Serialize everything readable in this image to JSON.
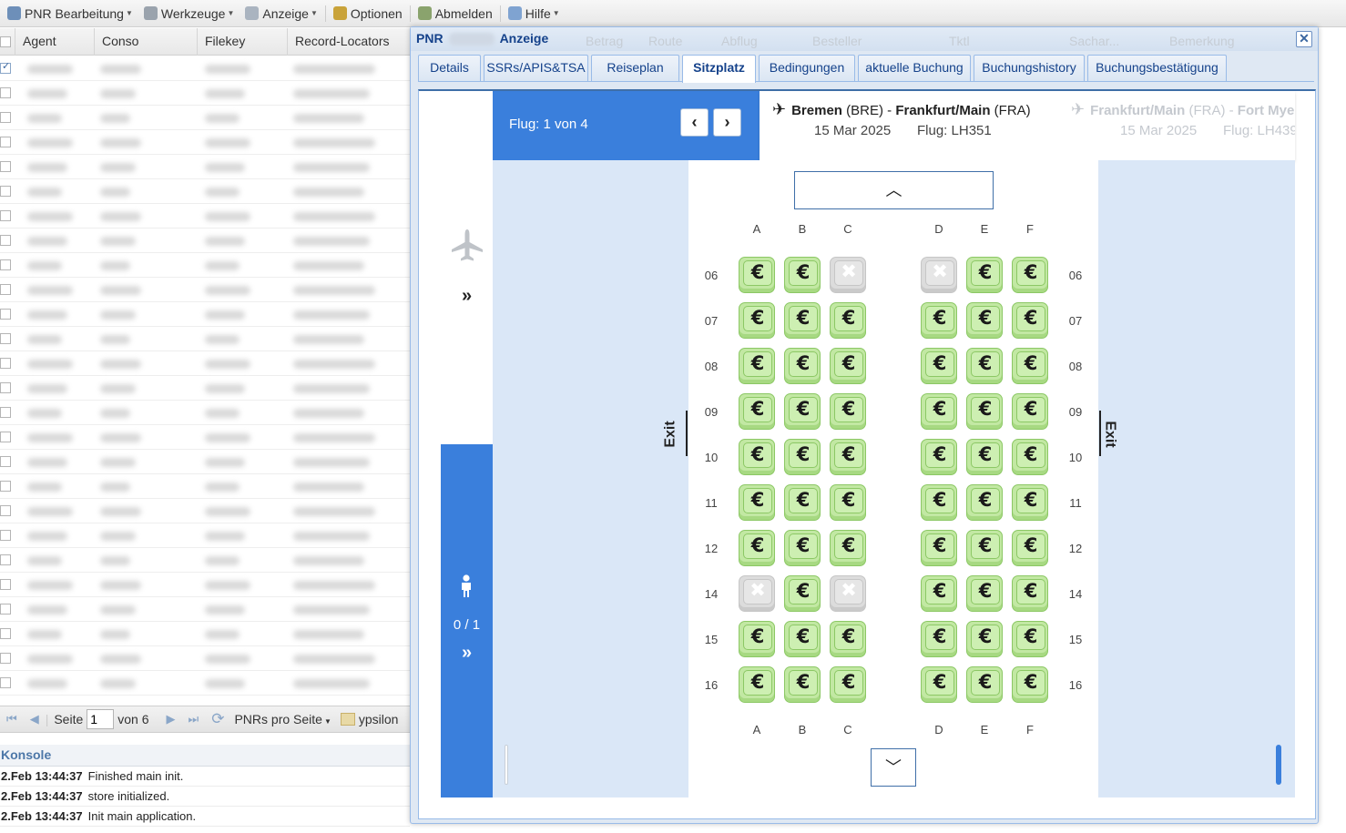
{
  "menu": {
    "items": [
      {
        "label": "PNR Bearbeitung",
        "icon": "pnr-edit-icon",
        "dropdown": true
      },
      {
        "label": "Werkzeuge",
        "icon": "tools-gear-icon",
        "dropdown": true
      },
      {
        "label": "Anzeige",
        "icon": "display-icon",
        "dropdown": true
      },
      {
        "label": "Optionen",
        "icon": "options-gear-icon",
        "dropdown": false
      },
      {
        "label": "Abmelden",
        "icon": "logout-icon",
        "dropdown": false
      },
      {
        "label": "Hilfe",
        "icon": "help-icon",
        "dropdown": true
      }
    ]
  },
  "grid": {
    "columns": [
      "Agent",
      "Conso",
      "Filekey",
      "Record-Locators"
    ]
  },
  "pager": {
    "page_label": "Seite",
    "page_value": "1",
    "of_label": "von 6",
    "per_page_label": "PNRs pro Seite",
    "user_label": "ypsilon"
  },
  "console": {
    "title": "Konsole",
    "lines": [
      {
        "time": "2.Feb 13:44:37",
        "text": "Finished main init."
      },
      {
        "time": "2.Feb 13:44:37",
        "text": "store initialized."
      },
      {
        "time": "2.Feb 13:44:37",
        "text": "Init main application."
      }
    ]
  },
  "dialog": {
    "title_prefix": "PNR",
    "title_suffix": "Anzeige",
    "close_icon": "close-icon",
    "tabs": [
      "Details",
      "SSRs/APIS&TSA",
      "Reiseplan",
      "Sitzplatz",
      "Bedingungen",
      "aktuelle Buchung",
      "Buchungshistory",
      "Buchungsbestätigung"
    ],
    "active_tab": "Sitzplatz",
    "ghost_columns": [
      "Betrag",
      "Route",
      "Abflug",
      "Besteller",
      "Tktl",
      "Sachar...",
      "Bemerkung"
    ]
  },
  "seatmap": {
    "flight_counter": "Flug: 1 von 4",
    "passenger_counter": "0 / 1",
    "flights": [
      {
        "from": "Bremen",
        "from_code": "(BRE)",
        "separator": " - ",
        "to": "Frankfurt/Main",
        "to_code": "(FRA)",
        "date": "15 Mar 2025",
        "flight": "Flug: LH351",
        "active": true
      },
      {
        "from": "Frankfurt/Main",
        "from_code": "(FRA)",
        "separator": " - ",
        "to": "Fort Mye",
        "to_code": "",
        "date": "15 Mar 2025",
        "flight": "Flug: LH439",
        "active": false
      }
    ],
    "columns_left": [
      "A",
      "B",
      "C"
    ],
    "columns_right": [
      "D",
      "E",
      "F"
    ],
    "exit_label": "Exit",
    "exit_row": "10",
    "seat_symbol_available": "€",
    "seat_symbol_occupied": "✖",
    "rows": [
      {
        "row": "06",
        "seats": [
          "avail",
          "avail",
          "occupied",
          "occupied",
          "avail",
          "avail"
        ]
      },
      {
        "row": "07",
        "seats": [
          "avail",
          "avail",
          "avail",
          "avail",
          "avail",
          "avail"
        ]
      },
      {
        "row": "08",
        "seats": [
          "avail",
          "avail",
          "avail",
          "avail",
          "avail",
          "avail"
        ]
      },
      {
        "row": "09",
        "seats": [
          "avail",
          "avail",
          "avail",
          "avail",
          "avail",
          "avail"
        ]
      },
      {
        "row": "10",
        "seats": [
          "avail",
          "avail",
          "avail",
          "avail",
          "avail",
          "avail"
        ]
      },
      {
        "row": "11",
        "seats": [
          "avail",
          "avail",
          "avail",
          "avail",
          "avail",
          "avail"
        ]
      },
      {
        "row": "12",
        "seats": [
          "avail",
          "avail",
          "avail",
          "avail",
          "avail",
          "avail"
        ]
      },
      {
        "row": "14",
        "seats": [
          "occupied",
          "avail",
          "occupied",
          "avail",
          "avail",
          "avail"
        ]
      },
      {
        "row": "15",
        "seats": [
          "avail",
          "avail",
          "avail",
          "avail",
          "avail",
          "avail"
        ]
      },
      {
        "row": "16",
        "seats": [
          "avail",
          "avail",
          "avail",
          "avail",
          "avail",
          "avail"
        ]
      }
    ]
  },
  "colors": {
    "accent_blue": "#3a7fdc",
    "seat_available": "#c2e8a3",
    "seat_occupied": "#dcdcdc",
    "title_blue": "#15428b"
  }
}
